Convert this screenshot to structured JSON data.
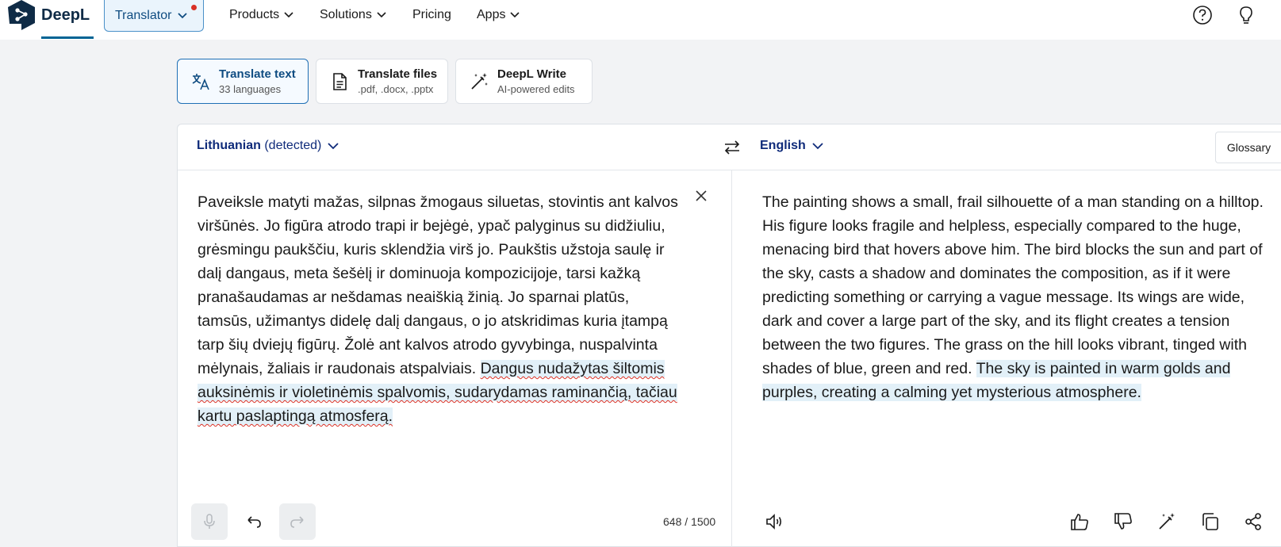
{
  "nav": {
    "logo_text": "DeepL",
    "translator_label": "Translator",
    "items": [
      {
        "label": "Products"
      },
      {
        "label": "Solutions"
      },
      {
        "label": "Pricing"
      },
      {
        "label": "Apps"
      }
    ],
    "right_icons": [
      "help-icon",
      "lightbulb-icon"
    ]
  },
  "modes": [
    {
      "title": "Translate text",
      "subtitle": "33 languages",
      "icon": "translate-icon",
      "active": true
    },
    {
      "title": "Translate files",
      "subtitle": ".pdf, .docx, .pptx",
      "icon": "file-icon",
      "active": false
    },
    {
      "title": "DeepL Write",
      "subtitle": "AI-powered edits",
      "icon": "magic-wand-icon",
      "active": false
    }
  ],
  "translator": {
    "source_lang": "Lithuanian",
    "source_lang_note": "(detected)",
    "target_lang": "English",
    "glossary_label": "Glossary",
    "source_text_plain": "Paveiksle matyti mažas, silpnas žmogaus siluetas, stovintis ant kalvos viršūnės. Jo figūra atrodo trapi ir bejėgė, ypač palyginus su didžiuliu, grėsmingu paukščiu, kuris sklendžia virš jo. Paukštis užstoja saulę ir dalį dangaus, meta šešėlį ir dominuoja kompozicijoje, tarsi kažką pranašaudamas ar nešdamas neaiškią žinią. Jo sparnai platūs, tamsūs, užimantys didelę dalį dangaus, o jo atskridimas kuria įtampą tarp šių dviejų figūrų. Žolė ant kalvos atrodo gyvybinga, nuspalvinta mėlynais, žaliais ir raudonais atspalviais. ",
    "source_text_highlight": "Dangus nudažytas šiltomis auksinėmis ir violetinėmis spalvomis, sudarydamas raminančią, tačiau kartu paslaptingą atmosferą.",
    "target_text_plain": "The painting shows a small, frail silhouette of a man standing on a hilltop. His figure looks fragile and helpless, especially compared to the huge, menacing bird that hovers above him. The bird blocks the sun and part of the sky, casts a shadow and dominates the composition, as if it were predicting something or carrying a vague message. Its wings are wide, dark and cover a large part of the sky, and its flight creates a tension between the two figures. The grass on the hill looks vibrant, tinged with shades of blue, green and red. ",
    "target_text_highlight": "The sky is painted in warm golds and purples, creating a calming yet mysterious atmosphere.",
    "char_count": "648 / 1500"
  },
  "colors": {
    "brand_navy": "#0f2b46",
    "accent_blue": "#1f6fb5",
    "highlight": "#e2f0f8",
    "notification_dot": "#d93025"
  }
}
